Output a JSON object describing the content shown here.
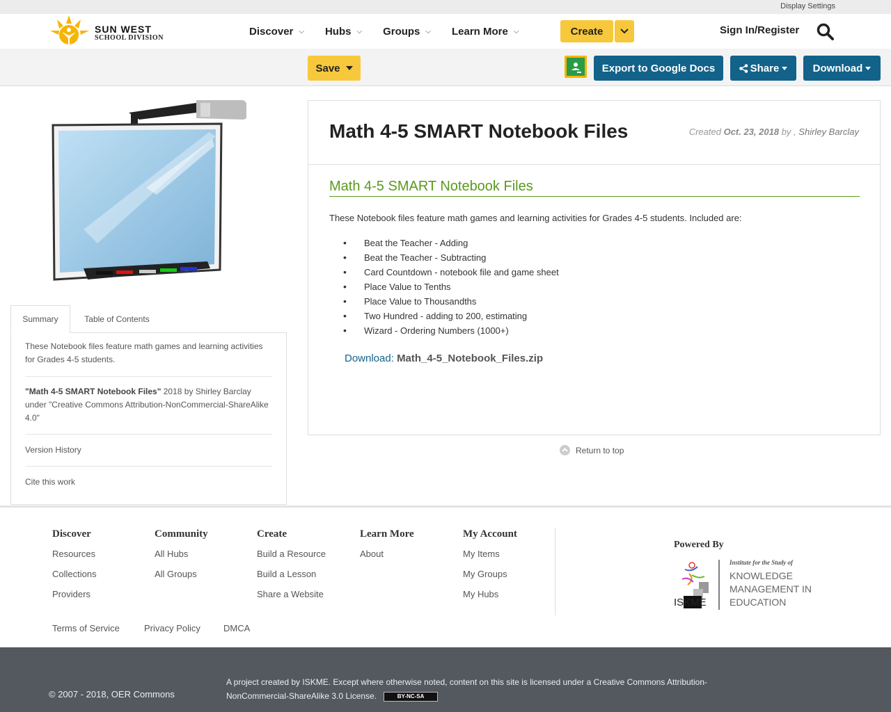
{
  "utility": {
    "display_settings": "Display Settings"
  },
  "header": {
    "logo_line1": "SUN WEST",
    "logo_line2": "SCHOOL DIVISION",
    "nav": [
      "Discover",
      "Hubs",
      "Groups",
      "Learn More"
    ],
    "create": "Create",
    "signin": "Sign In/Register"
  },
  "toolbar": {
    "save": "Save",
    "export": "Export to Google Docs",
    "share": "Share",
    "download": "Download"
  },
  "sidebar": {
    "tabs": [
      "Summary",
      "Table of Contents"
    ],
    "summary": "These Notebook files feature math games and learning activities for Grades 4-5 students.",
    "license_title": "\"Math 4-5 SMART Notebook Files\"",
    "license_rest": " 2018 by Shirley Barclay under \"Creative Commons Attribution-NonCommercial-ShareAlike 4.0\"",
    "version_history": "Version History",
    "cite": "Cite this work"
  },
  "resource": {
    "title": "Math 4-5 SMART Notebook Files",
    "created_label": "Created",
    "created_date": "Oct. 23, 2018",
    "by": "by ,",
    "author": "Shirley Barclay",
    "subtitle": "Math 4-5 SMART Notebook Files",
    "intro": "These Notebook files feature math games and learning activities for Grades 4-5 students. Included are:",
    "items": [
      "Beat the Teacher - Adding",
      "Beat the Teacher - Subtracting",
      "Card Countdown - notebook file and game sheet",
      "Place Value to Tenths",
      "Place Value to Thousandths",
      "Two Hundred - adding to 200, estimating",
      "Wizard - Ordering Numbers (1000+)"
    ],
    "download_label": "Download:",
    "download_file": "Math_4-5_Notebook_Files.zip",
    "return_top": "Return to top"
  },
  "footer": {
    "columns": [
      {
        "title": "Discover",
        "links": [
          "Resources",
          "Collections",
          "Providers"
        ]
      },
      {
        "title": "Community",
        "links": [
          "All Hubs",
          "All Groups"
        ]
      },
      {
        "title": "Create",
        "links": [
          "Build a Resource",
          "Build a Lesson",
          "Share a Website"
        ]
      },
      {
        "title": "Learn More",
        "links": [
          "About"
        ]
      },
      {
        "title": "My Account",
        "links": [
          "My Items",
          "My Groups",
          "My Hubs"
        ]
      }
    ],
    "powered_by": "Powered By",
    "iskme_small": "Institute for the Study of",
    "iskme_l1": "KNOWLEDGE",
    "iskme_l2": "MANAGEMENT IN",
    "iskme_l3": "EDUCATION",
    "iskme_mark": "ISKME",
    "legal": [
      "Terms of Service",
      "Privacy Policy",
      "DMCA"
    ],
    "copyright": "© 2007 - 2018, OER Commons",
    "project": "A project created by ISKME. Except where otherwise noted, content on this site is licensed under a Creative Commons Attribution-NonCommercial-ShareAlike 3.0 License.",
    "cc_badge": "BY-NC-SA"
  },
  "colors": {
    "accent_yellow": "#f7c83c",
    "brand_blue": "#12628a",
    "heading_green": "#5a9a1b"
  }
}
